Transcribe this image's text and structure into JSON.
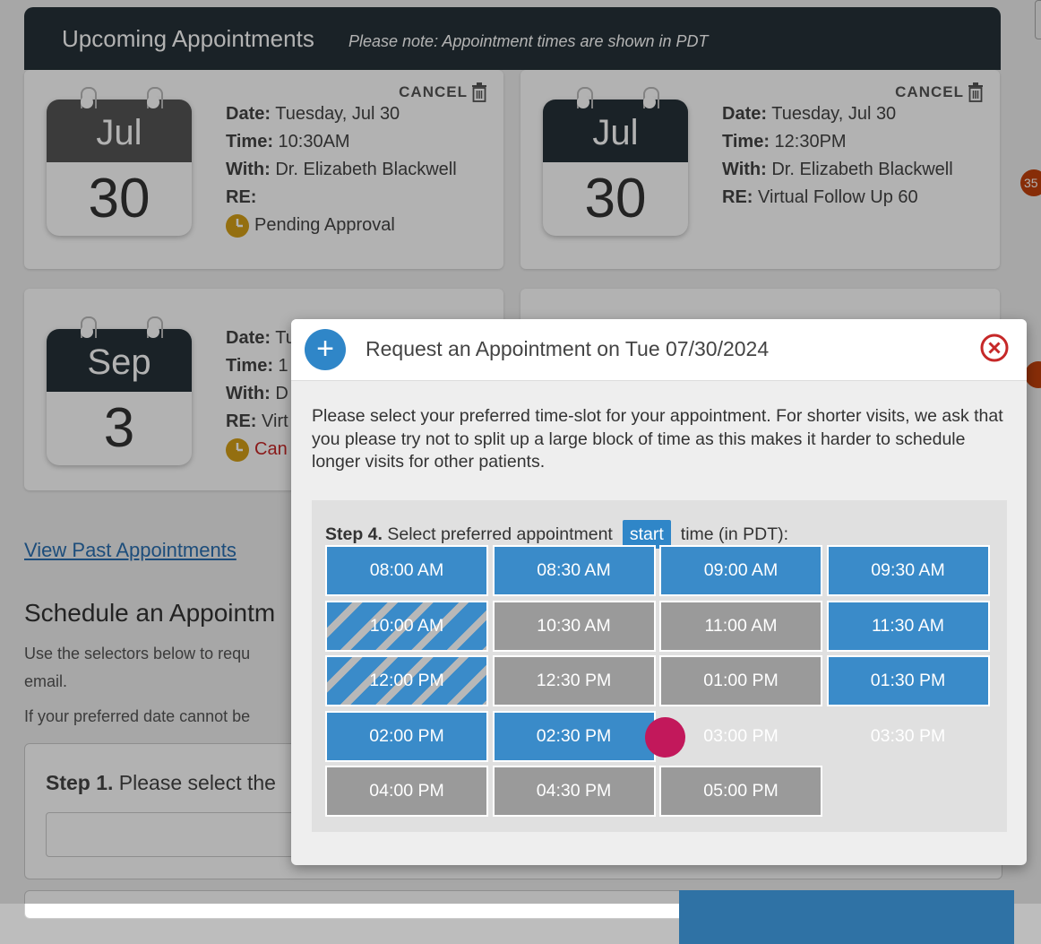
{
  "upcoming": {
    "title": "Upcoming Appointments",
    "note": "Please note: Appointment times are shown in PDT"
  },
  "appointments": [
    {
      "month": "Jul",
      "day": "30",
      "cancel": "CANCEL",
      "date_label": "Date:",
      "date": "Tuesday, Jul 30",
      "time_label": "Time:",
      "time": "10:30AM",
      "with_label": "With:",
      "with": "Dr. Elizabeth Blackwell",
      "re_label": "RE:",
      "re": "",
      "status": "Pending Approval",
      "header_color": "#555555"
    },
    {
      "month": "Jul",
      "day": "30",
      "cancel": "CANCEL",
      "date_label": "Date:",
      "date": "Tuesday, Jul 30",
      "time_label": "Time:",
      "time": "12:30PM",
      "with_label": "With:",
      "with": "Dr. Elizabeth Blackwell",
      "re_label": "RE:",
      "re": "Virtual Follow Up 60",
      "header_color": "#263238"
    },
    {
      "month": "Sep",
      "day": "3",
      "date_label": "Date:",
      "date": "Tu",
      "time_label": "Time:",
      "time": "1",
      "with_label": "With:",
      "with": "D",
      "re_label": "RE:",
      "re": "Virt",
      "status": "Can",
      "header_color": "#263238"
    }
  ],
  "past_link": "View Past Appointments",
  "schedule": {
    "title": "Schedule an Appointm",
    "text_line1": "Use the selectors below to requ",
    "text_line2": "email.",
    "text_line3": "If your preferred date cannot be",
    "step1_bold": "Step 1.",
    "step1_text": " Please select the"
  },
  "badge_right": "35",
  "modal": {
    "title": "Request an Appointment on Tue 07/30/2024",
    "description": "Please select your preferred time-slot for your appointment. For shorter visits, we ask that you please try not to split up a large block of time as this makes it harder to schedule longer visits for other patients.",
    "step4_bold": "Step 4.",
    "step4_text": "Select preferred appointment",
    "start_tag": "start",
    "step4_suffix": "time (in PDT):",
    "slots": [
      {
        "label": "08:00 AM",
        "state": "available"
      },
      {
        "label": "08:30 AM",
        "state": "available"
      },
      {
        "label": "09:00 AM",
        "state": "available"
      },
      {
        "label": "09:30 AM",
        "state": "available"
      },
      {
        "label": "10:00 AM",
        "state": "partial"
      },
      {
        "label": "10:30 AM",
        "state": "unavailable"
      },
      {
        "label": "11:00 AM",
        "state": "unavailable"
      },
      {
        "label": "11:30 AM",
        "state": "available"
      },
      {
        "label": "12:00 PM",
        "state": "partial"
      },
      {
        "label": "12:30 PM",
        "state": "unavailable"
      },
      {
        "label": "01:00 PM",
        "state": "unavailable"
      },
      {
        "label": "01:30 PM",
        "state": "available"
      },
      {
        "label": "02:00 PM",
        "state": "available"
      },
      {
        "label": "02:30 PM",
        "state": "available"
      },
      {
        "label": "03:00 PM",
        "state": "selected"
      },
      {
        "label": "03:30 PM",
        "state": "selected"
      },
      {
        "label": "04:00 PM",
        "state": "unavailable"
      },
      {
        "label": "04:30 PM",
        "state": "unavailable"
      },
      {
        "label": "05:00 PM",
        "state": "unavailable"
      }
    ]
  },
  "colors": {
    "accent": "#2f86c8",
    "slot_available": "#3a8bc9",
    "slot_unavailable": "#9a9a9a",
    "slot_selected": "#2f72a5",
    "close": "#c62828",
    "pending": "#d4a017",
    "cursor": "#c2185b"
  }
}
